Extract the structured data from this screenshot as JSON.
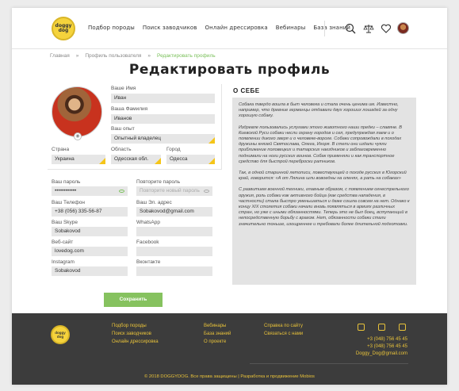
{
  "header": {
    "logo_text": "doggy dog",
    "nav": [
      "Подбор породы",
      "Поиск заводчиков",
      "Онлайн дрессировка",
      "Вебинары",
      "База знаний"
    ]
  },
  "breadcrumb": [
    "Главная",
    "Профиль пользователя",
    "Редактировать профиль"
  ],
  "page_title": "Редактировать профиль",
  "profile": {
    "first_name_label": "Ваше Имя",
    "first_name": "Иван",
    "last_name_label": "Ваша Фамилия",
    "last_name": "Иванов",
    "experience_label": "Ваш опыт",
    "experience": "Опытный владелец",
    "country_label": "Страна",
    "country": "Украина",
    "region_label": "Область",
    "region": "Одесская обл.",
    "city_label": "Город",
    "city": "Одесса"
  },
  "account": {
    "password_label": "Ваш пароль",
    "password": "••••••••••••",
    "repeat_label": "Повторите пароль",
    "repeat_placeholder": "Повторите новый пароль",
    "phone_label": "Ваш Телефон",
    "phone": "+38 (056) 335-56-87",
    "email_label": "Ваш Эл. адрес",
    "email": "Sobakovod@gmail.com",
    "skype_label": "Ваш Skype",
    "skype": "Sobakovod",
    "whatsapp_label": "WhatsApp",
    "whatsapp": "",
    "website_label": "Веб-сайт",
    "website": "lovedog.com",
    "facebook_label": "Facebook",
    "facebook": "",
    "instagram_label": "Instagram",
    "instagram": "Sobakovod",
    "vk_label": "Вконтакте",
    "vk": ""
  },
  "save_label": "Сохранить",
  "about": {
    "title": "О себе",
    "paragraphs": [
      "Собака твердо вошла в быт человека и стала очень ценима им. Известно, например, что древние германцы отдавали двух хороших лошадей за одну хорошую собаку.",
      "Издревле пользовались услугами этого животного наши предки – славяне. В Киевской Руси собаки несли охрану городов и сел, предупреждая лаем и о появлении дикого зверя и о человеке-вороге. Собаки сопровождали в походах дружины князей Святослава, Олега, Игоря. В степи они издали чуяли приближение половецких и татарских наездников и заблаговременно поднимали на ноги русских воинов. Собак применяли и как транспортное средство для быстрой переброски ратников.",
      "Так, в одной старинной летописи, повествующей о походе русских в Югорский край, говорится: «А от Лялина шли вовоедны на оленях, а рать на собаках»",
      "С развитием военной техники, главным образом, с появлением огнестрельного оружия, роль собаки как активного бойца (как средства нападения, в частности) стала быстро уменьшаться и даже сошла совсем на нет. Однако к концу XIX столетия собаки начали вновь появляться в армиях различных стран, но уже с иными обязанностями. Теперь это не был боец, вступающий в непосредственную борьбу с врагом. Нет, обязанности собаки стали значительно тоньше, изощреннее и требовали более длительной подготовки."
    ]
  },
  "footer": {
    "logo_text": "doggy dog",
    "col1": [
      "Подбор породы",
      "Поиск заводчиков",
      "Онлайн дрессировка"
    ],
    "col2": [
      "Вебинары",
      "База знаний",
      "О проекте"
    ],
    "col3": [
      "Справка по сайту",
      "Связаться с нами"
    ],
    "phones": [
      "+3 (048) 756 45 45",
      "+3 (048) 756 45 45",
      "Doggy_Dog@gmail.com"
    ],
    "copyright": "© 2018 DOGGYDOG. Все права защищены | Разработка и продвижение Mobios"
  },
  "colors": {
    "accent": "#86c25f",
    "yellow": "#f5c518",
    "footer_bg": "#3c3c3c"
  }
}
